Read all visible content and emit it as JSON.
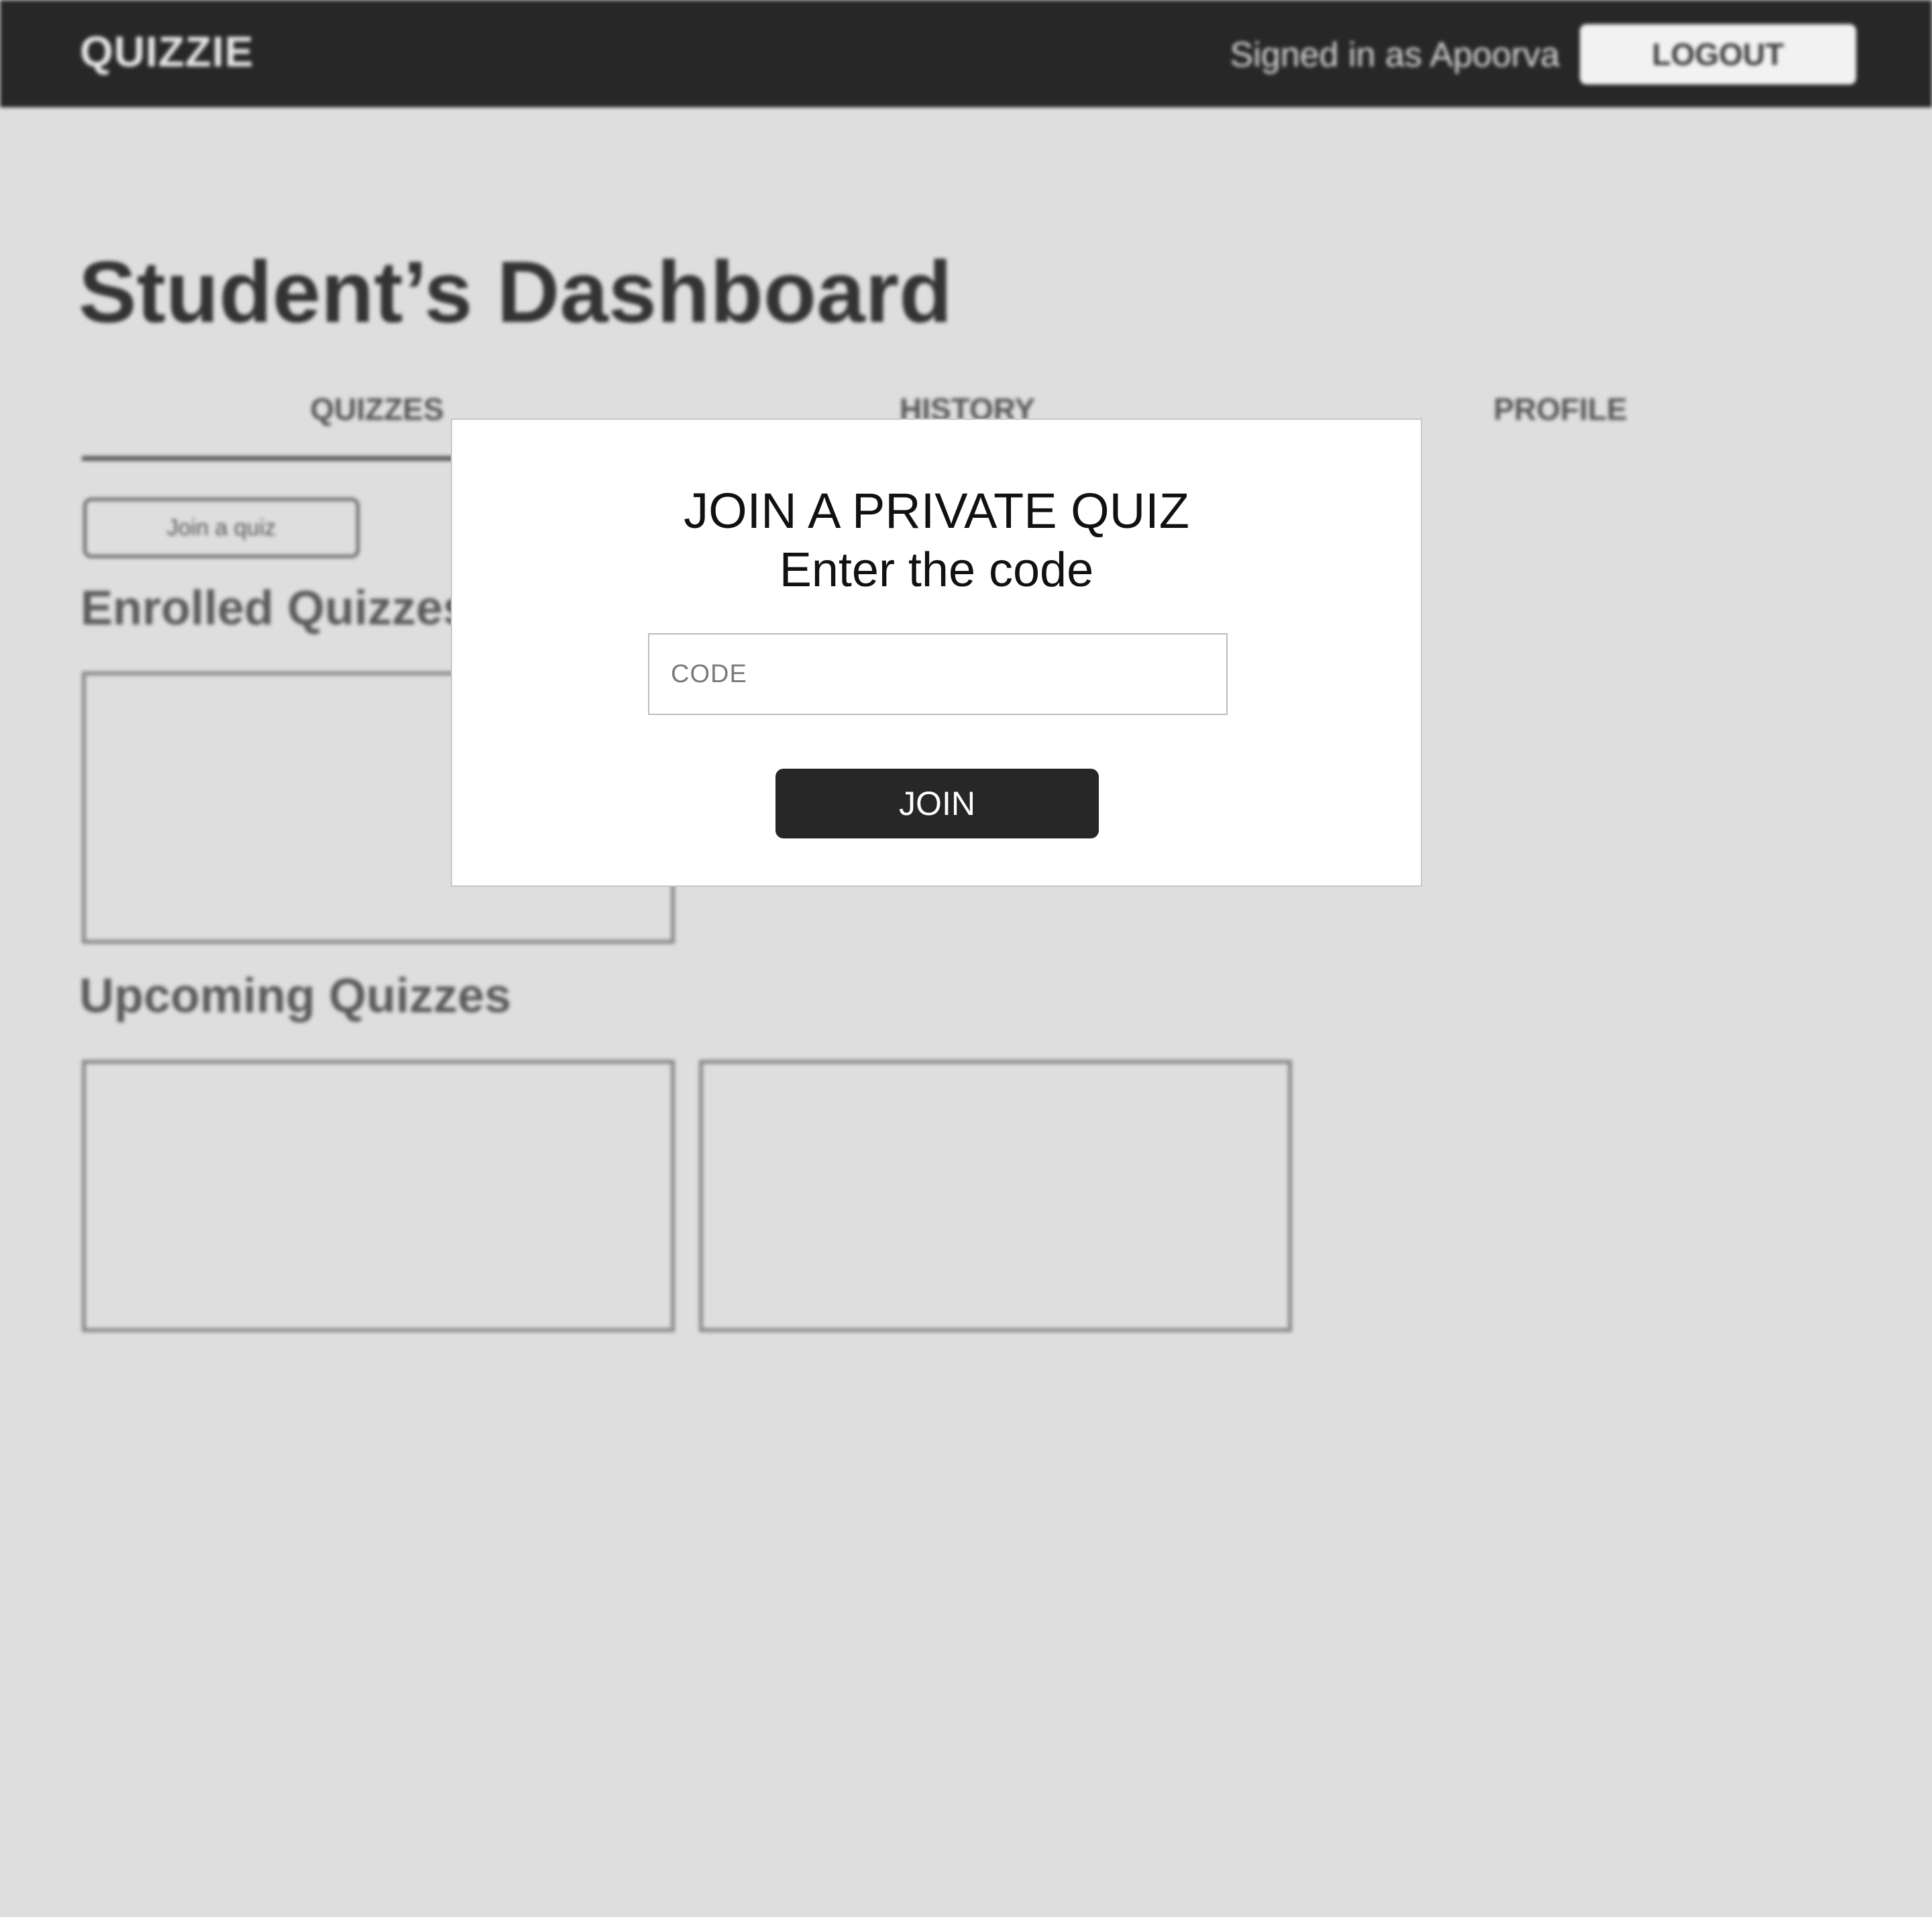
{
  "header": {
    "brand": "QUIZZIE",
    "signed_in_text": "Signed in as Apoorva",
    "logout_label": "LOGOUT"
  },
  "dashboard": {
    "title": "Student’s Dashboard",
    "tabs": [
      {
        "label": "QUIZZES",
        "active": true
      },
      {
        "label": "HISTORY",
        "active": false
      },
      {
        "label": "PROFILE",
        "active": false
      }
    ],
    "join_quiz_label": "Join a quiz",
    "enrolled_heading": "Enrolled Quizzes",
    "upcoming_heading": "Upcoming Quizzes"
  },
  "modal": {
    "title": "JOIN A PRIVATE QUIZ",
    "subtitle": "Enter the code",
    "code_placeholder": "CODE",
    "code_value": "",
    "join_label": "JOIN"
  },
  "colors": {
    "topbar": "#272727",
    "page_background": "#dedede",
    "modal_background": "#ffffff",
    "primary_button": "#272727"
  }
}
